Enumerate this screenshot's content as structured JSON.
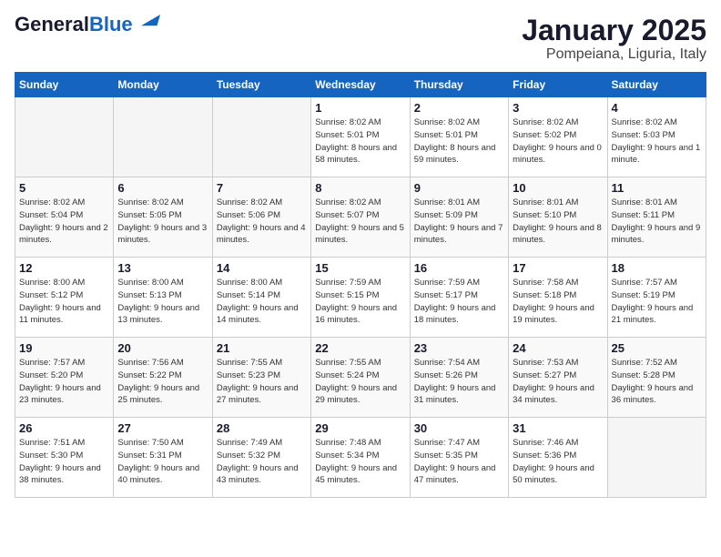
{
  "header": {
    "logo_line1": "General",
    "logo_line2": "Blue",
    "month": "January 2025",
    "location": "Pompeiana, Liguria, Italy"
  },
  "weekdays": [
    "Sunday",
    "Monday",
    "Tuesday",
    "Wednesday",
    "Thursday",
    "Friday",
    "Saturday"
  ],
  "weeks": [
    [
      {
        "day": "",
        "info": ""
      },
      {
        "day": "",
        "info": ""
      },
      {
        "day": "",
        "info": ""
      },
      {
        "day": "1",
        "info": "Sunrise: 8:02 AM\nSunset: 5:01 PM\nDaylight: 8 hours\nand 58 minutes."
      },
      {
        "day": "2",
        "info": "Sunrise: 8:02 AM\nSunset: 5:01 PM\nDaylight: 8 hours\nand 59 minutes."
      },
      {
        "day": "3",
        "info": "Sunrise: 8:02 AM\nSunset: 5:02 PM\nDaylight: 9 hours\nand 0 minutes."
      },
      {
        "day": "4",
        "info": "Sunrise: 8:02 AM\nSunset: 5:03 PM\nDaylight: 9 hours\nand 1 minute."
      }
    ],
    [
      {
        "day": "5",
        "info": "Sunrise: 8:02 AM\nSunset: 5:04 PM\nDaylight: 9 hours\nand 2 minutes."
      },
      {
        "day": "6",
        "info": "Sunrise: 8:02 AM\nSunset: 5:05 PM\nDaylight: 9 hours\nand 3 minutes."
      },
      {
        "day": "7",
        "info": "Sunrise: 8:02 AM\nSunset: 5:06 PM\nDaylight: 9 hours\nand 4 minutes."
      },
      {
        "day": "8",
        "info": "Sunrise: 8:02 AM\nSunset: 5:07 PM\nDaylight: 9 hours\nand 5 minutes."
      },
      {
        "day": "9",
        "info": "Sunrise: 8:01 AM\nSunset: 5:09 PM\nDaylight: 9 hours\nand 7 minutes."
      },
      {
        "day": "10",
        "info": "Sunrise: 8:01 AM\nSunset: 5:10 PM\nDaylight: 9 hours\nand 8 minutes."
      },
      {
        "day": "11",
        "info": "Sunrise: 8:01 AM\nSunset: 5:11 PM\nDaylight: 9 hours\nand 9 minutes."
      }
    ],
    [
      {
        "day": "12",
        "info": "Sunrise: 8:00 AM\nSunset: 5:12 PM\nDaylight: 9 hours\nand 11 minutes."
      },
      {
        "day": "13",
        "info": "Sunrise: 8:00 AM\nSunset: 5:13 PM\nDaylight: 9 hours\nand 13 minutes."
      },
      {
        "day": "14",
        "info": "Sunrise: 8:00 AM\nSunset: 5:14 PM\nDaylight: 9 hours\nand 14 minutes."
      },
      {
        "day": "15",
        "info": "Sunrise: 7:59 AM\nSunset: 5:15 PM\nDaylight: 9 hours\nand 16 minutes."
      },
      {
        "day": "16",
        "info": "Sunrise: 7:59 AM\nSunset: 5:17 PM\nDaylight: 9 hours\nand 18 minutes."
      },
      {
        "day": "17",
        "info": "Sunrise: 7:58 AM\nSunset: 5:18 PM\nDaylight: 9 hours\nand 19 minutes."
      },
      {
        "day": "18",
        "info": "Sunrise: 7:57 AM\nSunset: 5:19 PM\nDaylight: 9 hours\nand 21 minutes."
      }
    ],
    [
      {
        "day": "19",
        "info": "Sunrise: 7:57 AM\nSunset: 5:20 PM\nDaylight: 9 hours\nand 23 minutes."
      },
      {
        "day": "20",
        "info": "Sunrise: 7:56 AM\nSunset: 5:22 PM\nDaylight: 9 hours\nand 25 minutes."
      },
      {
        "day": "21",
        "info": "Sunrise: 7:55 AM\nSunset: 5:23 PM\nDaylight: 9 hours\nand 27 minutes."
      },
      {
        "day": "22",
        "info": "Sunrise: 7:55 AM\nSunset: 5:24 PM\nDaylight: 9 hours\nand 29 minutes."
      },
      {
        "day": "23",
        "info": "Sunrise: 7:54 AM\nSunset: 5:26 PM\nDaylight: 9 hours\nand 31 minutes."
      },
      {
        "day": "24",
        "info": "Sunrise: 7:53 AM\nSunset: 5:27 PM\nDaylight: 9 hours\nand 34 minutes."
      },
      {
        "day": "25",
        "info": "Sunrise: 7:52 AM\nSunset: 5:28 PM\nDaylight: 9 hours\nand 36 minutes."
      }
    ],
    [
      {
        "day": "26",
        "info": "Sunrise: 7:51 AM\nSunset: 5:30 PM\nDaylight: 9 hours\nand 38 minutes."
      },
      {
        "day": "27",
        "info": "Sunrise: 7:50 AM\nSunset: 5:31 PM\nDaylight: 9 hours\nand 40 minutes."
      },
      {
        "day": "28",
        "info": "Sunrise: 7:49 AM\nSunset: 5:32 PM\nDaylight: 9 hours\nand 43 minutes."
      },
      {
        "day": "29",
        "info": "Sunrise: 7:48 AM\nSunset: 5:34 PM\nDaylight: 9 hours\nand 45 minutes."
      },
      {
        "day": "30",
        "info": "Sunrise: 7:47 AM\nSunset: 5:35 PM\nDaylight: 9 hours\nand 47 minutes."
      },
      {
        "day": "31",
        "info": "Sunrise: 7:46 AM\nSunset: 5:36 PM\nDaylight: 9 hours\nand 50 minutes."
      },
      {
        "day": "",
        "info": ""
      }
    ]
  ]
}
